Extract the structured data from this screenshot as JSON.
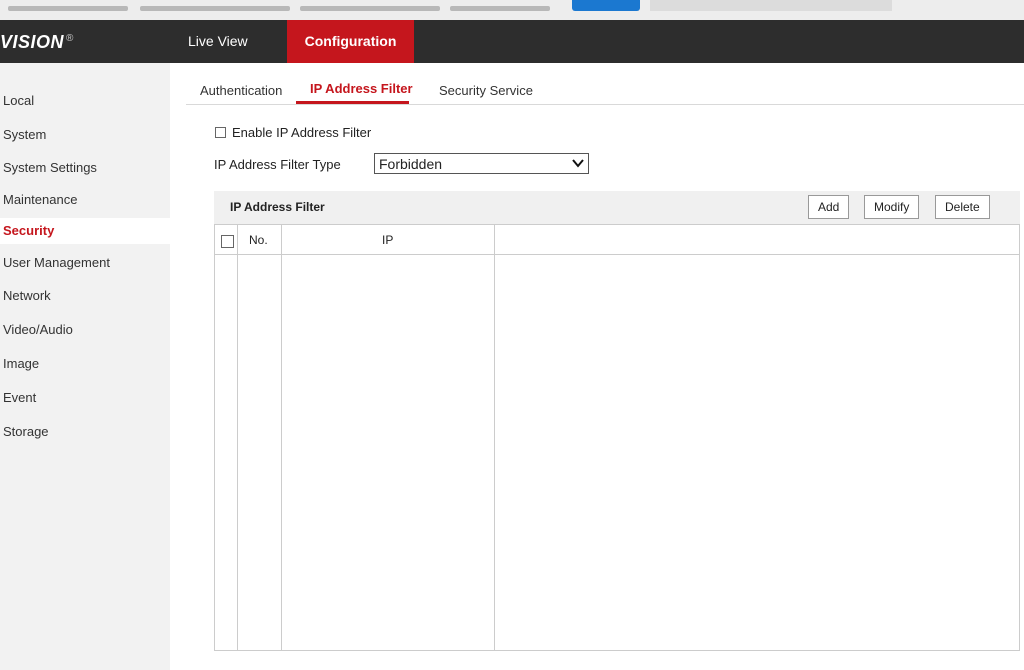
{
  "brand": {
    "logo_text": "VISION",
    "reg_mark": "®"
  },
  "topnav": {
    "live_view": "Live View",
    "configuration": "Configuration"
  },
  "sidebar": {
    "items": [
      {
        "label": "Local"
      },
      {
        "label": "System"
      },
      {
        "label": "System Settings"
      },
      {
        "label": "Maintenance"
      },
      {
        "label": "Security",
        "active": true
      },
      {
        "label": "User Management"
      },
      {
        "label": "Network"
      },
      {
        "label": "Video/Audio"
      },
      {
        "label": "Image"
      },
      {
        "label": "Event"
      },
      {
        "label": "Storage"
      }
    ]
  },
  "tabs": [
    {
      "label": "Authentication"
    },
    {
      "label": "IP Address Filter",
      "active": true
    },
    {
      "label": "Security Service"
    }
  ],
  "form": {
    "enable_label": "Enable IP Address Filter",
    "enable_checked": false,
    "type_label": "IP Address Filter Type",
    "type_value": "Forbidden"
  },
  "panel": {
    "title": "IP Address Filter",
    "add": "Add",
    "modify": "Modify",
    "delete": "Delete",
    "columns": {
      "no": "No.",
      "ip": "IP"
    }
  },
  "colors": {
    "accent": "#c5161d",
    "topbar": "#2d2d2d",
    "sidebar": "#f2f2f2"
  }
}
